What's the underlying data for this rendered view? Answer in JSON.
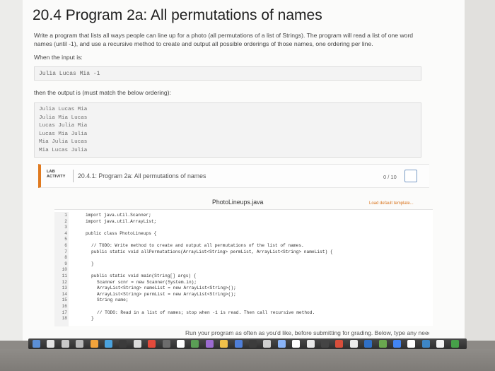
{
  "page": {
    "title": "20.4 Program 2a: All permutations of names",
    "description": "Write a program that lists all ways people can line up for a photo (all permutations of a list of Strings). The program will read a list of one word names (until -1), and use a recursive method to create and output all possible orderings of those names, one ordering per line.",
    "when_label": "When the input is:",
    "input_example": "Julia Lucas Mia -1",
    "then_label": "then the output is (must match the below ordering):",
    "output_lines": [
      "Julia Lucas Mia",
      "Julia Mia Lucas",
      "Lucas Julia Mia",
      "Lucas Mia Julia",
      "Mia Julia Lucas",
      "Mia Lucas Julia"
    ]
  },
  "lab": {
    "tag_line1": "LAB",
    "tag_line2": "ACTIVITY",
    "title": "20.4.1: Program 2a: All permutations of names",
    "score": "0 / 10"
  },
  "editor": {
    "filename": "PhotoLineups.java",
    "load_template": "Load default template...",
    "lines": [
      {
        "n": "1",
        "t": "import java.util.Scanner;",
        "cls": "kw",
        "ind": "ind0"
      },
      {
        "n": "2",
        "t": "import java.util.ArrayList;",
        "cls": "kw",
        "ind": "ind0"
      },
      {
        "n": "3",
        "t": "",
        "cls": "",
        "ind": "ind0"
      },
      {
        "n": "4",
        "t": "public class PhotoLineups {",
        "cls": "kw",
        "ind": "ind0"
      },
      {
        "n": "5",
        "t": "",
        "cls": "",
        "ind": "ind0"
      },
      {
        "n": "6",
        "t": "// TODO: Write method to create and output all permutations of the list of names.",
        "cls": "cm",
        "ind": "ind1"
      },
      {
        "n": "7",
        "t": "public static void allPermutations(ArrayList<String> permList, ArrayList<String> nameList) {",
        "cls": "kw",
        "ind": "ind1"
      },
      {
        "n": "8",
        "t": "",
        "cls": "",
        "ind": "ind1"
      },
      {
        "n": "9",
        "t": "}",
        "cls": "",
        "ind": "ind1"
      },
      {
        "n": "10",
        "t": "",
        "cls": "",
        "ind": "ind1"
      },
      {
        "n": "11",
        "t": "public static void main(String[] args) {",
        "cls": "kw",
        "ind": "ind1"
      },
      {
        "n": "12",
        "t": "Scanner scnr = new Scanner(System.in);",
        "cls": "",
        "ind": "ind2"
      },
      {
        "n": "13",
        "t": "ArrayList<String> nameList = new ArrayList<String>();",
        "cls": "",
        "ind": "ind2"
      },
      {
        "n": "14",
        "t": "ArrayList<String> permList = new ArrayList<String>();",
        "cls": "",
        "ind": "ind2"
      },
      {
        "n": "15",
        "t": "String name;",
        "cls": "",
        "ind": "ind2"
      },
      {
        "n": "16",
        "t": "",
        "cls": "",
        "ind": "ind2"
      },
      {
        "n": "17",
        "t": "// TODO: Read in a list of names; stop when -1 is read. Then call recursive method.",
        "cls": "cm",
        "ind": "ind2"
      },
      {
        "n": "18",
        "t": "}",
        "cls": "",
        "ind": "ind1"
      }
    ]
  },
  "footer": {
    "run_text": "Run your program as often as you'd like, before submitting for grading. Below, type any needed"
  },
  "dock": {
    "icon_colors": [
      "#5b8fd6",
      "#e3e3e3",
      "#c9c9c9",
      "#b9b9b9",
      "#f1a33b",
      "#4aa3df",
      "#3b3b3b",
      "#dcdcdc",
      "#e34a3b",
      "#6c6c6c",
      "#ffffff",
      "#5a9e55",
      "#9c6bd1",
      "#f0c04a",
      "#4f7fd9",
      "#3c3c3c",
      "#d0d0d0",
      "#8ab4f8",
      "#ffffff",
      "#e9e9e9",
      "#444444",
      "#d84e3b",
      "#ededed",
      "#2f70c7",
      "#6aa84f",
      "#4285f4",
      "#ffffff",
      "#3d86c6",
      "#f4f4f4",
      "#46a049"
    ]
  }
}
